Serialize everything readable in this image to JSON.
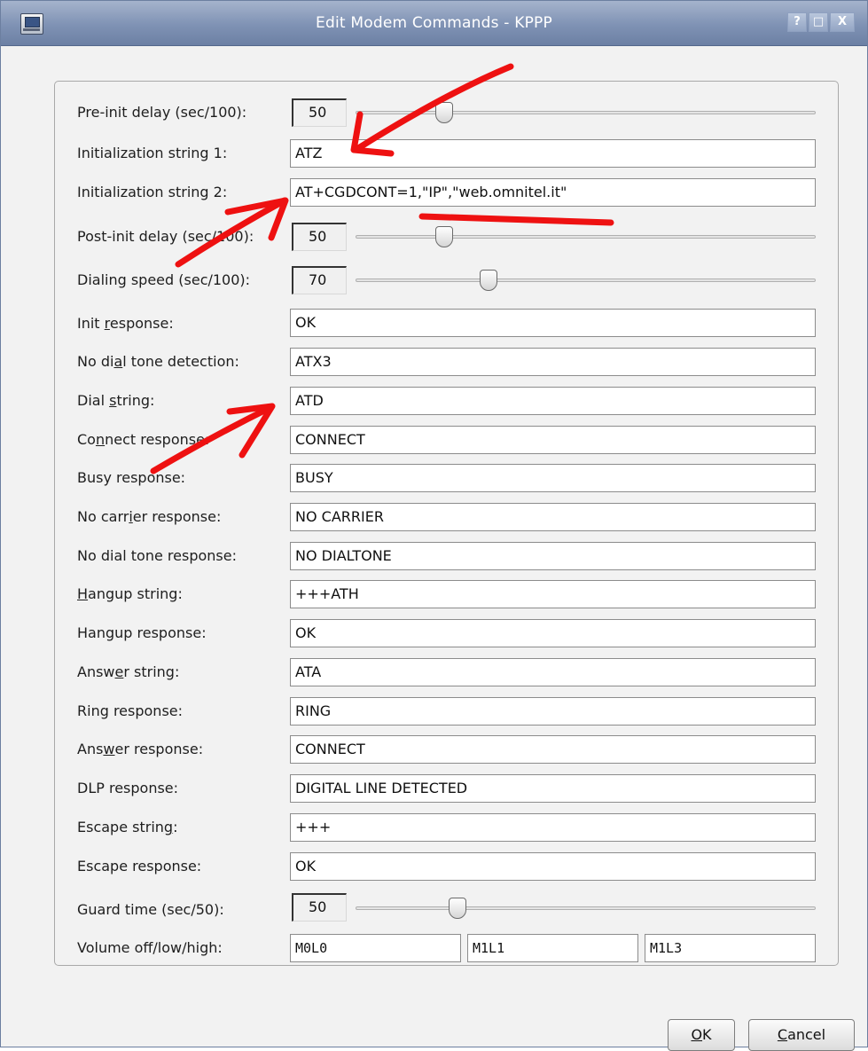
{
  "window": {
    "title": "Edit Modem Commands - KPPP",
    "buttons": {
      "help": "?",
      "maximize": "□",
      "close": "X"
    }
  },
  "sliders": [
    {
      "label": "Pre-init delay (sec/100):",
      "value": "50",
      "position_fraction": 0.18
    },
    {
      "label": "Post-init delay (sec/100):",
      "value": "50",
      "position_fraction": 0.18
    },
    {
      "label": "Dialing speed (sec/100):",
      "value": "70",
      "position_fraction": 0.28
    },
    {
      "label": "Guard time (sec/50):",
      "value": "50",
      "position_fraction": 0.21
    }
  ],
  "fields": {
    "init1": {
      "label": "Initialization string 1:",
      "value": "ATZ"
    },
    "init2": {
      "label": "Initialization string 2:",
      "value": "AT+CGDCONT=1,\"IP\",\"web.omnitel.it\""
    },
    "init_response": {
      "label_pre": "Init ",
      "label_key": "r",
      "label_post": "esponse:",
      "value": "OK"
    },
    "no_dial_tone_detection": {
      "label_pre": "No di",
      "label_key": "a",
      "label_post": "l tone detection:",
      "value": "ATX3"
    },
    "dial_string": {
      "label_pre": "Dial ",
      "label_key": "s",
      "label_post": "tring:",
      "value": "ATD"
    },
    "connect_response": {
      "label_pre": "Co",
      "label_key": "n",
      "label_post": "nect response:",
      "value": "CONNECT"
    },
    "busy_response": {
      "label": "Busy response:",
      "value": "BUSY"
    },
    "no_carrier_response": {
      "label_pre": "No carr",
      "label_key": "i",
      "label_post": "er response:",
      "value": "NO CARRIER"
    },
    "no_dial_tone_response": {
      "label": "No dial tone response:",
      "value": "NO DIALTONE"
    },
    "hangup_string": {
      "label_pre": "",
      "label_key": "H",
      "label_post": "angup string:",
      "value": "+++ATH"
    },
    "hangup_response": {
      "label": "Hangup response:",
      "value": "OK"
    },
    "answer_string": {
      "label_pre": "Answ",
      "label_key": "e",
      "label_post": "r string:",
      "value": "ATA"
    },
    "ring_response": {
      "label": "Ring response:",
      "value": "RING"
    },
    "answer_response": {
      "label_pre": "Ans",
      "label_key": "w",
      "label_post": "er response:",
      "value": "CONNECT"
    },
    "dlp_response": {
      "label": "DLP response:",
      "value": "DIGITAL LINE DETECTED"
    },
    "escape_string": {
      "label_pre": "Escape strin",
      "label_key": "g",
      "label_post": ":",
      "value": "+++"
    },
    "escape_response": {
      "label": "Escape response:",
      "value": "OK"
    }
  },
  "volume": {
    "label": "Volume off/low/high:",
    "off": "M0L0",
    "low": "M1L1",
    "high": "M1L3"
  },
  "dialog_buttons": {
    "ok_key": "O",
    "ok_rest": "K",
    "cancel_key": "C",
    "cancel_rest": "ancel"
  },
  "annotation_color": "#ee1111"
}
